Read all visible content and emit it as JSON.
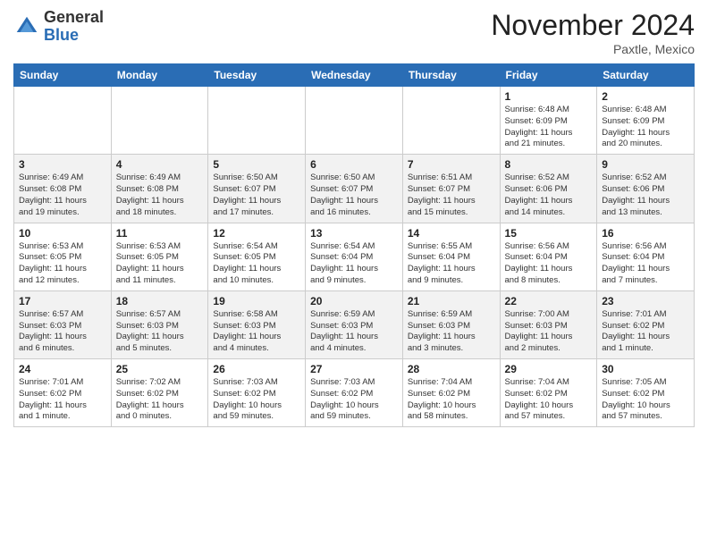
{
  "header": {
    "logo_general": "General",
    "logo_blue": "Blue",
    "month": "November 2024",
    "location": "Paxtle, Mexico"
  },
  "columns": [
    "Sunday",
    "Monday",
    "Tuesday",
    "Wednesday",
    "Thursday",
    "Friday",
    "Saturday"
  ],
  "weeks": [
    [
      {
        "day": "",
        "info": ""
      },
      {
        "day": "",
        "info": ""
      },
      {
        "day": "",
        "info": ""
      },
      {
        "day": "",
        "info": ""
      },
      {
        "day": "",
        "info": ""
      },
      {
        "day": "1",
        "info": "Sunrise: 6:48 AM\nSunset: 6:09 PM\nDaylight: 11 hours\nand 21 minutes."
      },
      {
        "day": "2",
        "info": "Sunrise: 6:48 AM\nSunset: 6:09 PM\nDaylight: 11 hours\nand 20 minutes."
      }
    ],
    [
      {
        "day": "3",
        "info": "Sunrise: 6:49 AM\nSunset: 6:08 PM\nDaylight: 11 hours\nand 19 minutes."
      },
      {
        "day": "4",
        "info": "Sunrise: 6:49 AM\nSunset: 6:08 PM\nDaylight: 11 hours\nand 18 minutes."
      },
      {
        "day": "5",
        "info": "Sunrise: 6:50 AM\nSunset: 6:07 PM\nDaylight: 11 hours\nand 17 minutes."
      },
      {
        "day": "6",
        "info": "Sunrise: 6:50 AM\nSunset: 6:07 PM\nDaylight: 11 hours\nand 16 minutes."
      },
      {
        "day": "7",
        "info": "Sunrise: 6:51 AM\nSunset: 6:07 PM\nDaylight: 11 hours\nand 15 minutes."
      },
      {
        "day": "8",
        "info": "Sunrise: 6:52 AM\nSunset: 6:06 PM\nDaylight: 11 hours\nand 14 minutes."
      },
      {
        "day": "9",
        "info": "Sunrise: 6:52 AM\nSunset: 6:06 PM\nDaylight: 11 hours\nand 13 minutes."
      }
    ],
    [
      {
        "day": "10",
        "info": "Sunrise: 6:53 AM\nSunset: 6:05 PM\nDaylight: 11 hours\nand 12 minutes."
      },
      {
        "day": "11",
        "info": "Sunrise: 6:53 AM\nSunset: 6:05 PM\nDaylight: 11 hours\nand 11 minutes."
      },
      {
        "day": "12",
        "info": "Sunrise: 6:54 AM\nSunset: 6:05 PM\nDaylight: 11 hours\nand 10 minutes."
      },
      {
        "day": "13",
        "info": "Sunrise: 6:54 AM\nSunset: 6:04 PM\nDaylight: 11 hours\nand 9 minutes."
      },
      {
        "day": "14",
        "info": "Sunrise: 6:55 AM\nSunset: 6:04 PM\nDaylight: 11 hours\nand 9 minutes."
      },
      {
        "day": "15",
        "info": "Sunrise: 6:56 AM\nSunset: 6:04 PM\nDaylight: 11 hours\nand 8 minutes."
      },
      {
        "day": "16",
        "info": "Sunrise: 6:56 AM\nSunset: 6:04 PM\nDaylight: 11 hours\nand 7 minutes."
      }
    ],
    [
      {
        "day": "17",
        "info": "Sunrise: 6:57 AM\nSunset: 6:03 PM\nDaylight: 11 hours\nand 6 minutes."
      },
      {
        "day": "18",
        "info": "Sunrise: 6:57 AM\nSunset: 6:03 PM\nDaylight: 11 hours\nand 5 minutes."
      },
      {
        "day": "19",
        "info": "Sunrise: 6:58 AM\nSunset: 6:03 PM\nDaylight: 11 hours\nand 4 minutes."
      },
      {
        "day": "20",
        "info": "Sunrise: 6:59 AM\nSunset: 6:03 PM\nDaylight: 11 hours\nand 4 minutes."
      },
      {
        "day": "21",
        "info": "Sunrise: 6:59 AM\nSunset: 6:03 PM\nDaylight: 11 hours\nand 3 minutes."
      },
      {
        "day": "22",
        "info": "Sunrise: 7:00 AM\nSunset: 6:03 PM\nDaylight: 11 hours\nand 2 minutes."
      },
      {
        "day": "23",
        "info": "Sunrise: 7:01 AM\nSunset: 6:02 PM\nDaylight: 11 hours\nand 1 minute."
      }
    ],
    [
      {
        "day": "24",
        "info": "Sunrise: 7:01 AM\nSunset: 6:02 PM\nDaylight: 11 hours\nand 1 minute."
      },
      {
        "day": "25",
        "info": "Sunrise: 7:02 AM\nSunset: 6:02 PM\nDaylight: 11 hours\nand 0 minutes."
      },
      {
        "day": "26",
        "info": "Sunrise: 7:03 AM\nSunset: 6:02 PM\nDaylight: 10 hours\nand 59 minutes."
      },
      {
        "day": "27",
        "info": "Sunrise: 7:03 AM\nSunset: 6:02 PM\nDaylight: 10 hours\nand 59 minutes."
      },
      {
        "day": "28",
        "info": "Sunrise: 7:04 AM\nSunset: 6:02 PM\nDaylight: 10 hours\nand 58 minutes."
      },
      {
        "day": "29",
        "info": "Sunrise: 7:04 AM\nSunset: 6:02 PM\nDaylight: 10 hours\nand 57 minutes."
      },
      {
        "day": "30",
        "info": "Sunrise: 7:05 AM\nSunset: 6:02 PM\nDaylight: 10 hours\nand 57 minutes."
      }
    ]
  ]
}
